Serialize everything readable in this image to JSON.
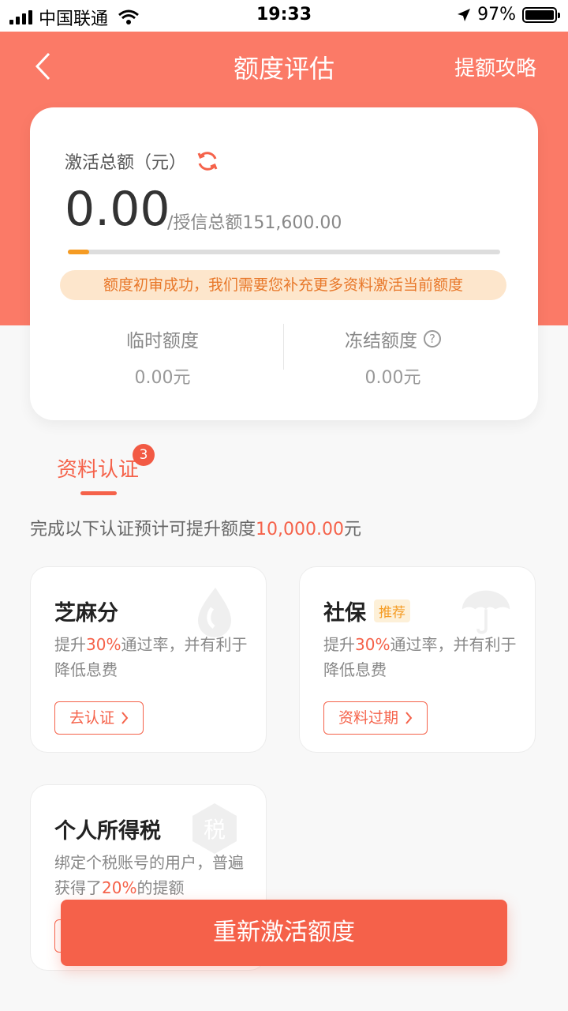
{
  "status_bar": {
    "carrier": "中国联通",
    "time": "19:33",
    "battery": "97%"
  },
  "header": {
    "title": "额度评估",
    "right_link": "提额攻略"
  },
  "credit_card": {
    "label": "激活总额（元）",
    "amount": "0.00",
    "total_credit": "/授信总额151,600.00",
    "progress": 0.0,
    "notice": "额度初审成功，我们需要您补充更多资料激活当前额度",
    "temp": {
      "label": "临时额度",
      "value": "0.00元"
    },
    "frozen": {
      "label": "冻结额度",
      "value": "0.00元"
    }
  },
  "tab": {
    "label": "资料认证",
    "badge": "3"
  },
  "hint": {
    "prefix": "完成以下认证预计可提升额度",
    "amount": "10,000.00",
    "suffix": "元"
  },
  "auth_items": [
    {
      "title": "芝麻分",
      "desc_pre": "提升",
      "pct": "30%",
      "desc_post": "通过率，并有利于降低息费",
      "button": "去认证",
      "icon": "sesame-icon"
    },
    {
      "title": "社保",
      "tag": "推荐",
      "desc_pre": "提升",
      "pct": "30%",
      "desc_post": "通过率，并有利于降低息费",
      "button": "资料过期",
      "icon": "umbrella-icon"
    },
    {
      "title": "个人所得税",
      "desc_pre": "绑定个税账号的用户，普遍获得了",
      "pct": "20%",
      "desc_post": "的提额",
      "icon": "tax-icon"
    }
  ],
  "cta": {
    "label": "重新激活额度"
  },
  "colors": {
    "accent": "#f5624a",
    "hero": "#fb7a67",
    "warning": "#f59b23"
  }
}
